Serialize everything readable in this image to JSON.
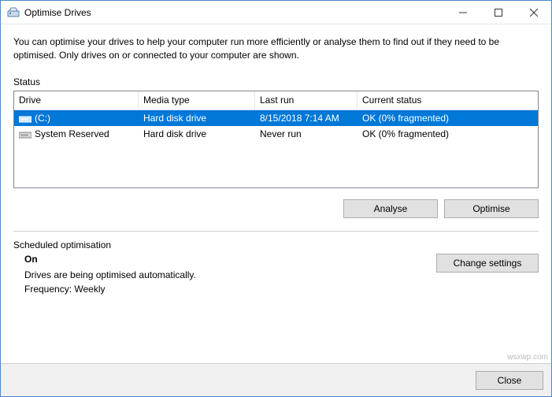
{
  "window": {
    "title": "Optimise Drives"
  },
  "description": "You can optimise your drives to help your computer run more efficiently or analyse them to find out if they need to be optimised. Only drives on or connected to your computer are shown.",
  "status_label": "Status",
  "columns": {
    "drive": "Drive",
    "media": "Media type",
    "last": "Last run",
    "status": "Current status"
  },
  "rows": [
    {
      "drive": "(C:)",
      "media": "Hard disk drive",
      "last": "8/15/2018 7:14 AM",
      "status": "OK (0% fragmented)",
      "selected": true
    },
    {
      "drive": "System Reserved",
      "media": "Hard disk drive",
      "last": "Never run",
      "status": "OK (0% fragmented)",
      "selected": false
    }
  ],
  "buttons": {
    "analyse": "Analyse",
    "optimise": "Optimise",
    "change": "Change settings",
    "close": "Close"
  },
  "scheduled": {
    "label": "Scheduled optimisation",
    "state": "On",
    "line1": "Drives are being optimised automatically.",
    "line2": "Frequency: Weekly"
  },
  "watermark": "wsxwp.com"
}
